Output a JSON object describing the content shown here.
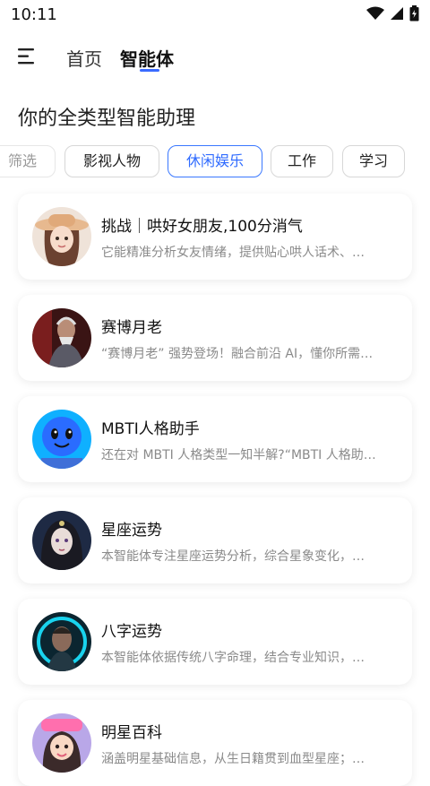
{
  "status_bar": {
    "time": "10:11"
  },
  "nav": {
    "home_label": "首页",
    "agent_label": "智能体"
  },
  "headline": "你的全类型智能助理",
  "categories": [
    {
      "label": "筛选",
      "state": "partial"
    },
    {
      "label": "影视人物",
      "state": "normal"
    },
    {
      "label": "休闲娱乐",
      "state": "active"
    },
    {
      "label": "工作",
      "state": "normal"
    },
    {
      "label": "学习",
      "state": "normal"
    }
  ],
  "agents": [
    {
      "title": "挑战｜哄好女朋友,100分消气",
      "desc": "它能精准分析女友情绪，提供贴心哄人话术、…",
      "avatar_icon": "girl-hat-avatar"
    },
    {
      "title": "赛博月老",
      "desc": "“赛博月老” 强势登场！融合前沿 AI，懂你所需…",
      "avatar_icon": "old-man-avatar"
    },
    {
      "title": "MBTI人格助手",
      "desc": "还在对 MBTI 人格类型一知半解?“MBTI 人格助…",
      "avatar_icon": "blue-robot-avatar"
    },
    {
      "title": "星座运势",
      "desc": "本智能体专注星座运势分析，综合星象变化，…",
      "avatar_icon": "constellation-girl-avatar"
    },
    {
      "title": "八字运势",
      "desc": "本智能体依据传统八字命理，结合专业知识，…",
      "avatar_icon": "cyber-man-avatar"
    },
    {
      "title": "明星百科",
      "desc": "涵盖明星基础信息，从生日籍贯到血型星座；…",
      "avatar_icon": "cartoon-star-avatar"
    }
  ],
  "colors": {
    "accent": "#2f6bff",
    "text_primary": "#111111",
    "text_secondary": "#8a8a8a"
  }
}
